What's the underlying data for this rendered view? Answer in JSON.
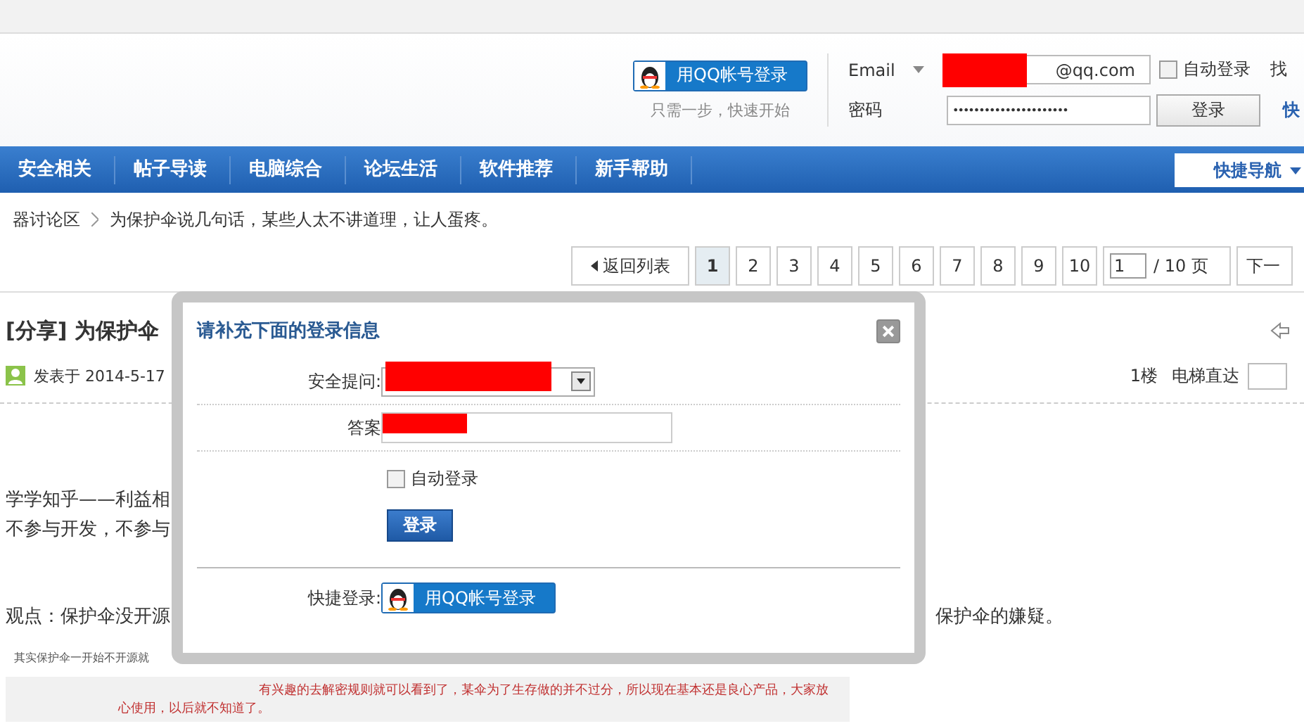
{
  "header": {
    "qq_button": "用QQ帐号登录",
    "qq_hint": "只需一步，快速开始",
    "email_label": "Email",
    "email_value": "@qq.com",
    "auto_login": {
      "label": "自动登录",
      "checked": false
    },
    "find_link": "找",
    "password_label": "密码",
    "password_mask": "••••••••••••••••••••••",
    "login_button": "登录",
    "quick_link": "快"
  },
  "nav": {
    "items": [
      {
        "label": "安全相关"
      },
      {
        "label": "帖子导读"
      },
      {
        "label": "电脑综合"
      },
      {
        "label": "论坛生活"
      },
      {
        "label": "软件推荐"
      },
      {
        "label": "新手帮助"
      }
    ],
    "quick_nav": "快捷导航"
  },
  "breadcrumb": [
    "器讨论区",
    "为保护伞说几句话，某些人太不讲道理，让人蛋疼。"
  ],
  "pagination": {
    "back": "返回列表",
    "pages": [
      {
        "label": "1",
        "selected": true
      },
      {
        "label": "2",
        "selected": false
      },
      {
        "label": "3",
        "selected": false
      },
      {
        "label": "4",
        "selected": false
      },
      {
        "label": "5",
        "selected": false
      },
      {
        "label": "6",
        "selected": false
      },
      {
        "label": "7",
        "selected": false
      },
      {
        "label": "8",
        "selected": false
      },
      {
        "label": "9",
        "selected": false
      },
      {
        "label": "10",
        "selected": false
      }
    ],
    "page_input": "1",
    "total": "/ 10 页",
    "next": "下一"
  },
  "post": {
    "title": "[分享] 为保护伞",
    "meta": "发表于 2014-5-17",
    "floor": "1楼",
    "jump_label": "电梯直达",
    "lines": [
      {
        "left": "学学知乎——利益相"
      },
      {
        "left": "不参与开发，不参与"
      },
      {
        "left": "观点：保护伞没开源",
        "right": "保护伞的嫌疑。"
      }
    ],
    "quote_line": "其实保护伞一开始不开源就",
    "red_lines": [
      "有兴趣的去解密规则就可以看到了，某伞为了生存做的并不过分，所以现在基本还是良心产品，大家放",
      "心使用，以后就不知道了。"
    ]
  },
  "dialog": {
    "title": "请补充下面的登录信息",
    "question_label": "安全提问:",
    "answer_label": "答案",
    "auto_login": {
      "label": "自动登录",
      "checked": false
    },
    "submit": "登录",
    "quick_login_label": "快捷登录:",
    "qq_button": "用QQ帐号登录"
  }
}
